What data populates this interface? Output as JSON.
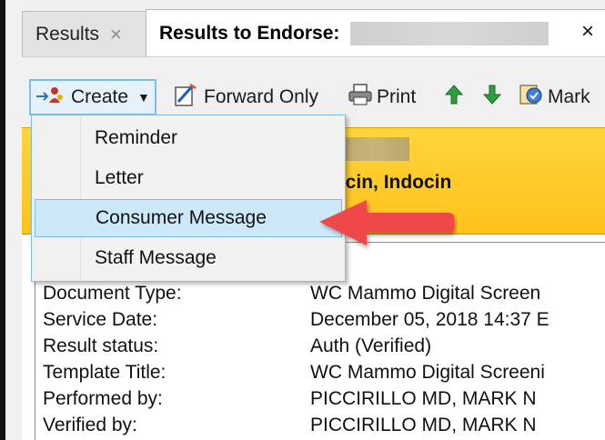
{
  "tabs": [
    {
      "label": "Results",
      "close": "×"
    },
    {
      "label": "Results to Endorse:",
      "close": "×"
    }
  ],
  "toolbar": {
    "create_label": "Create",
    "forward_label": "Forward Only",
    "print_label": "Print",
    "mark_label": "Mark"
  },
  "menu": {
    "items": [
      "Reminder",
      "Letter",
      "Consumer Message",
      "Staff Message"
    ],
    "selected": "Consumer Message"
  },
  "banner": {
    "allergies": "ycin, Indocin"
  },
  "details": [
    {
      "label": "Document Type:",
      "value": "WC Mammo Digital Screen"
    },
    {
      "label": "Service Date:",
      "value": "December 05, 2018 14:37 E"
    },
    {
      "label": "Result status:",
      "value": "Auth (Verified)"
    },
    {
      "label": "Template Title:",
      "value": "WC Mammo Digital Screeni"
    },
    {
      "label": "Performed by:",
      "value": "PICCIRILLO MD, MARK N"
    },
    {
      "label": "Verified by:",
      "value": "PICCIRILLO MD, MARK N"
    }
  ],
  "colors": {
    "banner": "#ffc21a",
    "menu_highlight": "#cde8f8",
    "annotation_arrow": "#f0464b"
  },
  "icons": {
    "create": "create-action-icon",
    "forward": "forward-edit-icon",
    "print": "printer-icon",
    "up": "up-arrow-icon",
    "down": "down-arrow-icon",
    "mark": "mark-icon"
  }
}
